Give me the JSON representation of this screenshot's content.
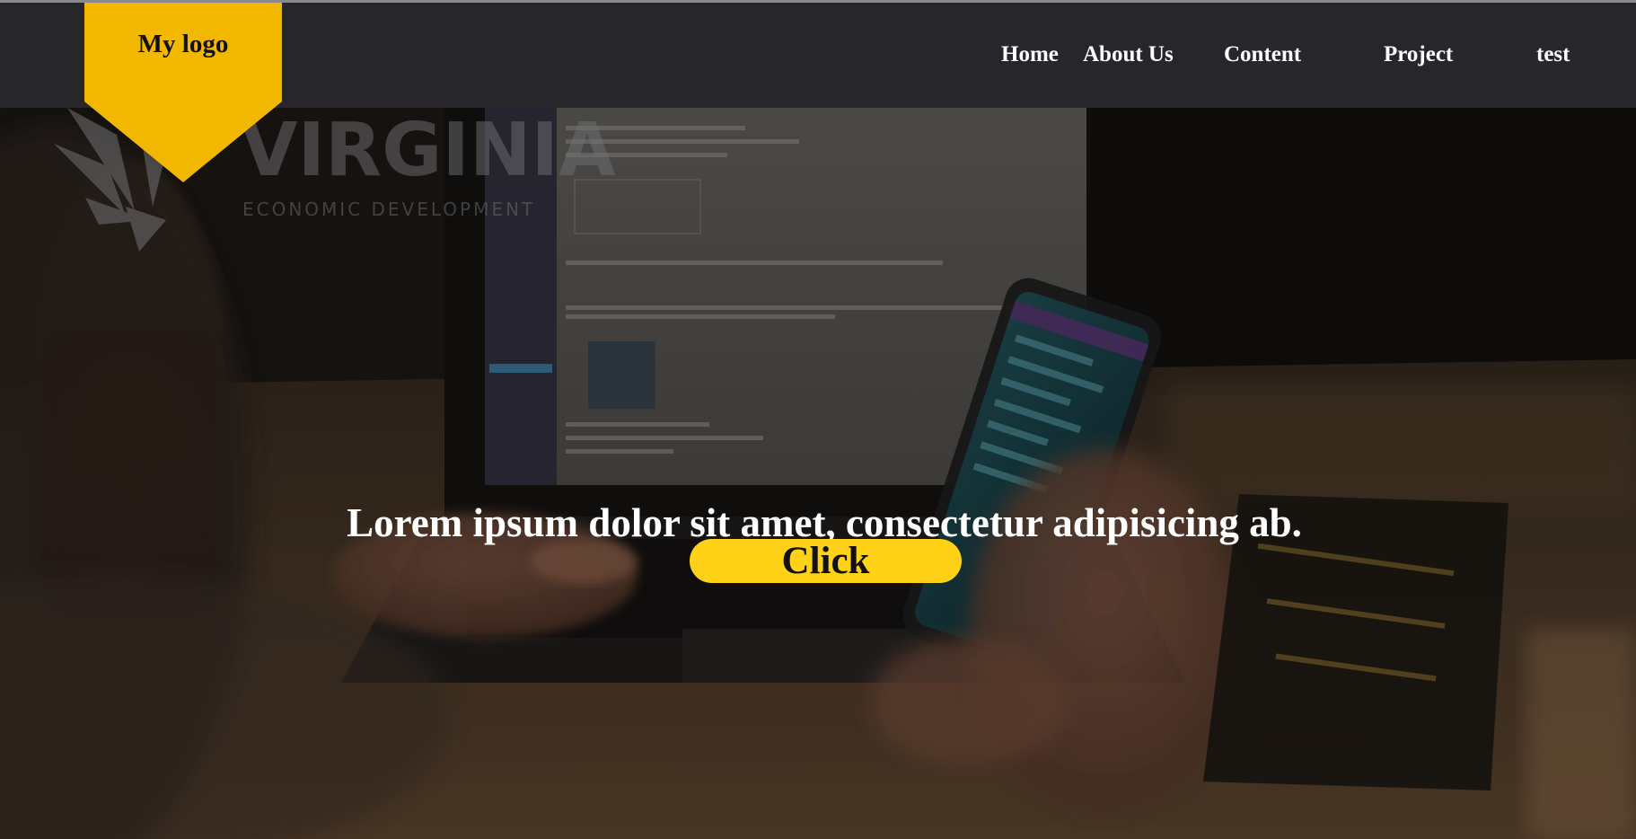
{
  "logo": {
    "text": "My logo",
    "color": "#f2b800"
  },
  "nav": {
    "items": [
      {
        "label": "Home"
      },
      {
        "label": "About Us"
      },
      {
        "label": "Content"
      },
      {
        "label": "Project"
      },
      {
        "label": "test"
      }
    ]
  },
  "hero": {
    "headline": "Lorem ipsum dolor sit amet, consectetur adipisicing ab.",
    "button_label": "Click",
    "button_color": "#ffd218",
    "background_watermark": {
      "title": "VIRGINIA",
      "subtitle": "ECONOMIC DEVELOPMENT",
      "icon": "star-burst-icon"
    }
  },
  "colors": {
    "header_bg": "#26262b",
    "logo_badge": "#f2b800",
    "cta": "#ffd218",
    "text_light": "#ffffff"
  }
}
